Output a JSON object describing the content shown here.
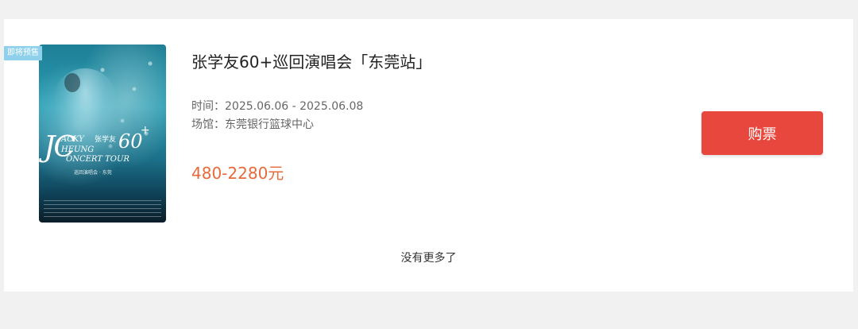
{
  "event": {
    "badge": "即将预售",
    "title": "张学友60+巡回演唱会「东莞站」",
    "time_label": "时间：",
    "time_value": "2025.06.06 - 2025.06.08",
    "venue_label": "场馆：",
    "venue_value": "东莞银行篮球中心",
    "price": "480-2280元",
    "buy_label": "购票"
  },
  "poster": {
    "jc": "JC",
    "acky": "ACKY",
    "cn_name": "张学友",
    "heung": "HEUNG",
    "sixty": "60",
    "plus": "+",
    "tour": "ONCERT TOUR",
    "sub": "巡回演唱会 · 东莞"
  },
  "footer": {
    "no_more": "没有更多了"
  },
  "colors": {
    "accent": "#e8473d",
    "price": "#e86a3a",
    "badge": "#8fd1ec"
  }
}
